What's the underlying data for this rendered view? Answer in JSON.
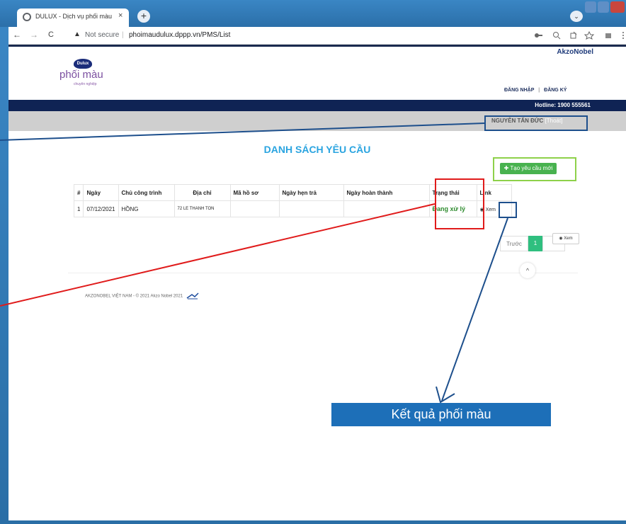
{
  "browser": {
    "tab_title": "DULUX - Dịch vụ phối màu",
    "tab_close": "×",
    "new_tab": "+",
    "security_text": "Not secure",
    "url": "phoimaudulux.dppp.vn/PMS/List",
    "nav_back": "←",
    "nav_forward": "→",
    "nav_reload": "C",
    "warn_icon": "▲",
    "profile_chevron": "⌄"
  },
  "site": {
    "brand_top": "AkzoNobel",
    "logo_dulux": "Dulux",
    "logo_main": "phối màu",
    "logo_sub": "chuyên nghiệp",
    "login": "ĐĂNG NHẬP",
    "sep": "|",
    "register": "ĐĂNG KÝ",
    "hotline": "Hotline: 1900 555561",
    "user_name": "NGUYỄN TẤN ĐỨC",
    "logout": "[Thoát]"
  },
  "main": {
    "title": "DANH SÁCH YÊU CẦU",
    "create_button": "Tạo yêu cầu mới",
    "columns": [
      "#",
      "Ngày",
      "Chủ công trình",
      "Địa chỉ",
      "Mã hồ sơ",
      "Ngày hẹn trả",
      "Ngày hoàn thành",
      "Trạng thái",
      "Link"
    ],
    "rows": [
      {
        "idx": "1",
        "date": "07/12/2021",
        "owner": "HỒNG",
        "address": "72 LE THANH TON",
        "code": "",
        "due": "",
        "done": "",
        "status": "Đang xử lý",
        "link": "Xem"
      }
    ],
    "pager": {
      "prev": "Trước",
      "current": "1"
    },
    "tooltip": "Xem",
    "to_top": "^"
  },
  "footer": {
    "text": "AKZONOBEL VIỆT NAM - © 2021 Akzo Nobel 2021"
  },
  "annotation": {
    "callout_bold": "Kết quả phối",
    "callout_thin": "màu"
  },
  "colors": {
    "accent_red": "#e01b1b",
    "accent_blue": "#1d4f8c",
    "accent_green": "#8ed14a"
  }
}
